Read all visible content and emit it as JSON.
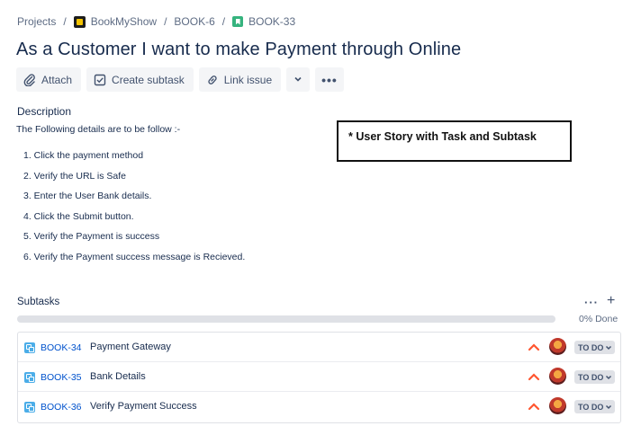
{
  "breadcrumb": {
    "projects": "Projects",
    "project": "BookMyShow",
    "parent": "BOOK-6",
    "issue": "BOOK-33"
  },
  "issue": {
    "title": "As a Customer I want to make Payment through Online"
  },
  "toolbar": {
    "attach": "Attach",
    "create_subtask": "Create subtask",
    "link_issue": "Link issue"
  },
  "description": {
    "label": "Description",
    "intro": "The Following details are to be follow :-",
    "steps": [
      "1. Click the payment method",
      "2. Verify the URL is Safe",
      "3. Enter the User Bank details.",
      "4. Click the Submit button.",
      "5. Verify the Payment is success",
      "6. Verify the Payment success message is Recieved."
    ]
  },
  "note": "* User Story with Task and Subtask",
  "subtasks": {
    "label": "Subtasks",
    "progress_percent": 0,
    "progress_text": "0% Done",
    "items": [
      {
        "key": "BOOK-34",
        "summary": "Payment Gateway",
        "status": "TO DO"
      },
      {
        "key": "BOOK-35",
        "summary": "Bank Details",
        "status": "TO DO"
      },
      {
        "key": "BOOK-36",
        "summary": "Verify Payment Success",
        "status": "TO DO"
      }
    ]
  },
  "colors": {
    "link": "#0052cc",
    "priority_high": "#ff5630",
    "subtask_icon": "#4bade8",
    "story_icon": "#36b37e"
  }
}
